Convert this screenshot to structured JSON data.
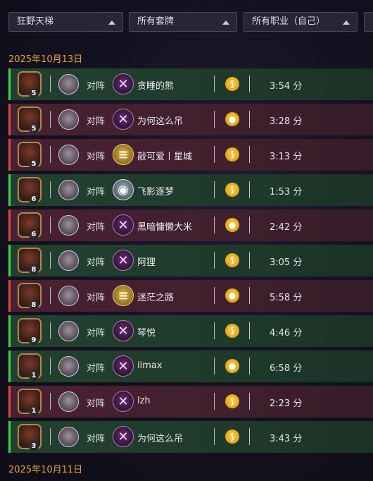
{
  "filters": {
    "mode": "狂野天梯",
    "decks": "所有套牌",
    "classes": "所有职业（自己）"
  },
  "sections": [
    {
      "date": "2025年10月13日",
      "games": [
        {
          "result": "win",
          "rank": "5",
          "opponent_class": "dh",
          "opponent": "贪睡的熊",
          "coin": "first",
          "duration": "3:54 分"
        },
        {
          "result": "loss",
          "rank": "5",
          "opponent_class": "dh",
          "opponent": "为何这么吊",
          "coin": "second",
          "duration": "3:28 分"
        },
        {
          "result": "loss",
          "rank": "5",
          "opponent_class": "pal",
          "opponent": "敲可爱丨星城",
          "coin": "first",
          "duration": "3:13 分"
        },
        {
          "result": "win",
          "rank": "6",
          "opponent_class": "pri",
          "opponent": "飞影逐梦",
          "coin": "first",
          "duration": "1:53 分"
        },
        {
          "result": "loss",
          "rank": "6",
          "opponent_class": "dh",
          "opponent": "黑暗慵懒大米",
          "coin": "second",
          "duration": "2:42 分"
        },
        {
          "result": "win",
          "rank": "8",
          "opponent_class": "dh",
          "opponent": "阿狸",
          "coin": "first",
          "duration": "3:05 分"
        },
        {
          "result": "loss",
          "rank": "8",
          "opponent_class": "pal",
          "opponent": "迷茫之路",
          "coin": "second",
          "duration": "5:58 分"
        },
        {
          "result": "win",
          "rank": "9",
          "opponent_class": "dh",
          "opponent": "琴悦",
          "coin": "first",
          "duration": "4:46 分"
        },
        {
          "result": "win",
          "rank": "1",
          "opponent_class": "dh",
          "opponent": "ilmax",
          "coin": "second",
          "duration": "6:58 分"
        },
        {
          "result": "loss",
          "rank": "1",
          "opponent_class": "dh",
          "opponent": "lzh",
          "coin": "first",
          "duration": "2:23 分"
        },
        {
          "result": "win",
          "rank": "3",
          "opponent_class": "dh",
          "opponent": "为何这么吊",
          "coin": "first",
          "duration": "3:43 分"
        }
      ]
    },
    {
      "date": "2025年10月11日",
      "games": []
    }
  ],
  "labels": {
    "vs": "对阵"
  },
  "colors": {
    "win": "#46d24c",
    "loss": "#e0474f",
    "date": "#e9a53a"
  },
  "icons": {
    "dh": "demon-hunter-icon",
    "pal": "paladin-icon",
    "pri": "priest-icon",
    "coin_first": "first-turn-icon",
    "coin_second": "coin-icon"
  }
}
